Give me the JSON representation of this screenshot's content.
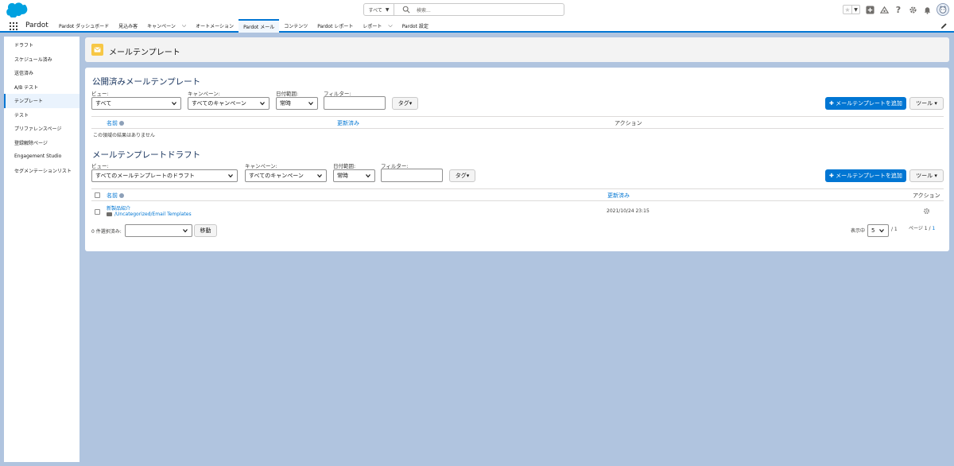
{
  "header": {
    "search_scope": "すべて",
    "search_placeholder": "検索..."
  },
  "nav": {
    "app_name": "Pardot",
    "tabs": [
      {
        "label": "Pardot ダッシュボード"
      },
      {
        "label": "見込み客"
      },
      {
        "label": "キャンペーン"
      },
      {
        "label": "オートメーション"
      },
      {
        "label": "Pardot メール"
      },
      {
        "label": "コンテンツ"
      },
      {
        "label": "Pardot レポート"
      },
      {
        "label": "レポート"
      },
      {
        "label": "Pardot 設定"
      }
    ]
  },
  "sidebar": {
    "items": [
      {
        "label": "ドラフト"
      },
      {
        "label": "スケジュール済み"
      },
      {
        "label": "送信済み"
      },
      {
        "label": "A/B テスト"
      },
      {
        "label": "テンプレート"
      },
      {
        "label": "テスト"
      },
      {
        "label": "プリファレンスページ"
      },
      {
        "label": "登録解除ページ"
      },
      {
        "label": "Engagement Studio"
      },
      {
        "label": "セグメンテーションリスト"
      }
    ]
  },
  "page": {
    "title": "メールテンプレート"
  },
  "published": {
    "title": "公開済みメールテンプレート",
    "view_label": "ビュー:",
    "view_value": "すべて",
    "campaign_label": "キャンペーン:",
    "campaign_value": "すべてのキャンペーン",
    "date_label": "日付範囲:",
    "date_value": "常時",
    "filter_label": "フィルター:",
    "tag_button": "タグ▾",
    "add_button": "✚ メールテンプレートを追加",
    "tools_button": "ツール ▾",
    "col_name": "名前",
    "col_updated": "更新済み",
    "col_action": "アクション",
    "empty_message": "この領域の結果はありません"
  },
  "drafts": {
    "title": "メールテンプレートドラフト",
    "view_label": "ビュー:",
    "view_value": "すべてのメールテンプレートのドラフト",
    "campaign_label": "キャンペーン:",
    "campaign_value": "すべてのキャンペーン",
    "date_label": "日付範囲:",
    "date_value": "常時",
    "filter_label": "フィルター:",
    "tag_button": "タグ▾",
    "add_button": "✚ メールテンプレートを追加",
    "tools_button": "ツール ▾",
    "col_name": "名前",
    "col_updated": "更新済み",
    "col_action": "アクション",
    "rows": [
      {
        "name": "新製品紹介",
        "folder": "/Uncategorized/Email Templates",
        "updated": "2021/10/24 23:15"
      }
    ],
    "selected_count": "0 件選択済み:",
    "move_button": "移動",
    "display_label": "表示中",
    "per_page": "5",
    "of_total": "/ 1",
    "page_prefix": "ページ 1 /",
    "page_total": "1"
  }
}
